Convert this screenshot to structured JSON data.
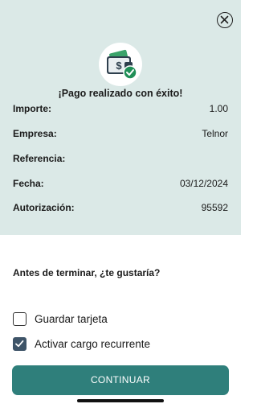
{
  "header": {
    "close_icon": "close-circle-icon",
    "success_icon": "wallet-check-icon",
    "title": "¡Pago realizado con éxito!"
  },
  "details": [
    {
      "label": "Importe:",
      "value": "1.00"
    },
    {
      "label": "Empresa:",
      "value": "Telnor"
    },
    {
      "label": "Referencia:",
      "value": ""
    },
    {
      "label": "Fecha:",
      "value": "03/12/2024"
    },
    {
      "label": "Autorización:",
      "value": "95592"
    }
  ],
  "options": {
    "question": "Antes de terminar, ¿te gustaría?",
    "items": [
      {
        "label": "Guardar tarjeta",
        "checked": false
      },
      {
        "label": "Activar cargo recurrente",
        "checked": true
      }
    ]
  },
  "actions": {
    "continue_label": "CONTINUAR"
  },
  "colors": {
    "panel_bg": "#dbe9e7",
    "primary_button": "#2f7f7b",
    "checkbox_checked": "#3e5468",
    "success_green": "#1f8f57"
  }
}
